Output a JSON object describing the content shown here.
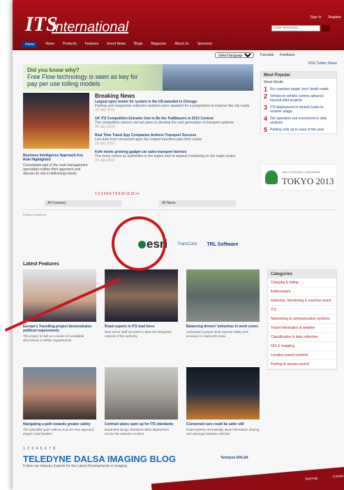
{
  "header": {
    "logo": "ITS",
    "title": "International",
    "toplinks": [
      "Sign In",
      "Register"
    ],
    "search_placeholder": "Enter keywords...",
    "advanced": "Advanced Search"
  },
  "nav": [
    "Home",
    "News",
    "Products",
    "Features",
    "Event News",
    "Blogs",
    "Magazine",
    "About Us",
    "Sponsors"
  ],
  "language": {
    "selected": "Select language",
    "links": [
      "Translate",
      "Feedback"
    ]
  },
  "banner": {
    "line1": "Did you know why?",
    "line2": "Free Flow technology is seen as key for",
    "line3": "pay per use tolling models"
  },
  "featured": {
    "title": "Business Intelligence Approach Key Role Highlighted",
    "text": "Consultants part of the road management specialists outline their approach and discuss its role in delivering results"
  },
  "breaking": {
    "heading": "Breaking News",
    "items": [
      {
        "title": "Largest open tender for system in the US awarded in Chicago",
        "text": "Parking and congestion collection systems were awarded for a programme to improve the city roads",
        "date": "29 July 2013"
      },
      {
        "title": "UK ITS Competition Entrants Vow to Be the Trailblazers in 2013 Contest",
        "text": "The competition winners set out plans to develop the next generation of transport systems",
        "date": "29 July 2013"
      },
      {
        "title": "Real Time Travel App Companies Achieve Transport Success",
        "text": "Live data from connected apps has helped travellers plan their routes",
        "date": "29 July 2013"
      },
      {
        "title": "Kofe meets growing gadget car sales transport barriers",
        "text": "The move comes as authorities in the region look to expand monitoring on the major routes",
        "date": "29 July 2013"
      }
    ],
    "pager": "1 2 3 4 5 6 7 8 9 10 11 12 >>",
    "all_features": "All Features",
    "all_news": "All News"
  },
  "sidebar": {
    "icons": "RSS Twitter Share",
    "most_popular": "Most Popular",
    "tabs": "Week   Month",
    "items": [
      {
        "n": "1",
        "t": "Six countries target 'zero' death roads"
      },
      {
        "n": "2",
        "t": "Vehicle-to-vehicle comms advance beyond pilot projects"
      },
      {
        "n": "3",
        "t": "ITS deployment in tunnels looks to smarter usage"
      },
      {
        "n": "4",
        "t": "Toll operators see investment in data analysis"
      },
      {
        "n": "5",
        "t": "Parking sets up to ease of the year"
      }
    ],
    "congress_small": "20th ITS WORLD CONGRESS",
    "congress_big": "TOKYO 2013"
  },
  "sponsors": {
    "label": "Platinum sponsors",
    "esri": "esri",
    "logo2": "TransCore",
    "logo3": "TRL Software"
  },
  "latest": {
    "heading": "Latest Features",
    "cards": [
      {
        "title": "Europe's Travelling project demonstrates political requirements",
        "text": "The project is built on a series of roundtable discussions to define requirements"
      },
      {
        "title": "Road experts in ITS lead force",
        "text": "New senior staff recruited to drive the integrated network of the authority"
      },
      {
        "title": "Balancing drivers' behaviour in work zones",
        "text": "Automated systems help improve safety and accuracy in road work areas"
      },
      {
        "title": "Navigating a path towards greater safety",
        "text": "The specialist team outlines how the new approach targets road fatalities"
      },
      {
        "title": "Contract plans open up for ITS standards",
        "text": "Expanded design standards allow deployment across the network corridors"
      },
      {
        "title": "Connected cars could be safer still",
        "text": "Road systems increasingly allow information sharing and warnings between vehicles"
      }
    ]
  },
  "categories": {
    "heading": "Categories",
    "items": [
      "Charging & tolling",
      "Enforcement",
      "Detection, Monitoring & machine vision",
      "ITS",
      "Networking & communication systems",
      "Travel information & weather",
      "Classification & data collection",
      "GIS & mapping",
      "Location based systems",
      "Parking & access control"
    ]
  },
  "blog": {
    "dots": "1 2 3 4 5 6 7 8",
    "title": "TELEDYNE DALSA IMAGING BLOG",
    "sub": "Follow our Industry Experts for the Latest Developments in Imaging",
    "logo": "Teledyne DALSA"
  },
  "footer": [
    "Sitemap",
    "Contact Us"
  ]
}
